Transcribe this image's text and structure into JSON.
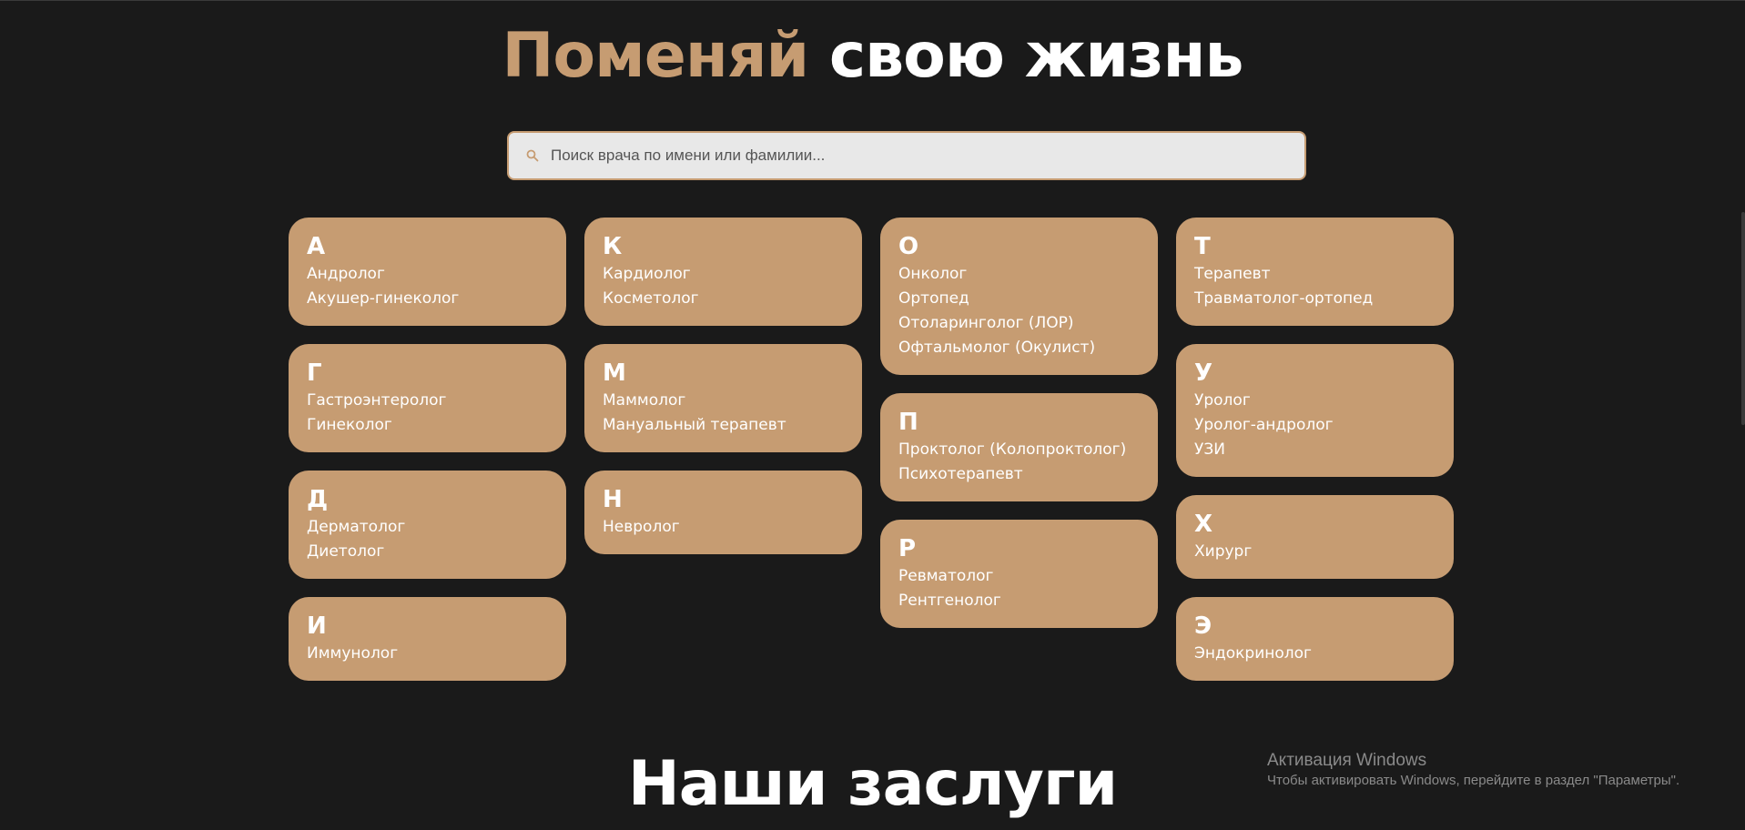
{
  "hero": {
    "title_accent": "Поменяй",
    "title_rest": "свою жизнь"
  },
  "search": {
    "placeholder": "Поиск врача по имени или фамилии...",
    "value": "",
    "icon": "search-icon"
  },
  "columns": [
    [
      {
        "letter": "А",
        "items": [
          "Андролог",
          "Акушер-гинеколог"
        ]
      },
      {
        "letter": "Г",
        "items": [
          "Гастроэнтеролог",
          "Гинеколог"
        ]
      },
      {
        "letter": "Д",
        "items": [
          "Дерматолог",
          "Диетолог"
        ]
      },
      {
        "letter": "И",
        "items": [
          "Иммунолог"
        ]
      }
    ],
    [
      {
        "letter": "К",
        "items": [
          "Кардиолог",
          "Косметолог"
        ]
      },
      {
        "letter": "М",
        "items": [
          "Маммолог",
          "Мануальный терапевт"
        ]
      },
      {
        "letter": "Н",
        "items": [
          "Невролог"
        ]
      }
    ],
    [
      {
        "letter": "О",
        "items": [
          "Онколог",
          "Ортопед",
          "Отоларинголог (ЛОР)",
          "Офтальмолог (Окулист)"
        ]
      },
      {
        "letter": "П",
        "items": [
          "Проктолог (Колопроктолог)",
          "Психотерапевт"
        ]
      },
      {
        "letter": "Р",
        "items": [
          "Ревматолог",
          "Рентгенолог"
        ]
      }
    ],
    [
      {
        "letter": "Т",
        "items": [
          "Терапевт",
          "Травматолог-ортопед"
        ]
      },
      {
        "letter": "У",
        "items": [
          "Уролог",
          "Уролог-андролог",
          "УЗИ"
        ]
      },
      {
        "letter": "Х",
        "items": [
          "Хирург"
        ]
      },
      {
        "letter": "Э",
        "items": [
          "Эндокринолог"
        ]
      }
    ]
  ],
  "merits": {
    "title": "Наши заслуги"
  },
  "windows_activation": {
    "title": "Активация Windows",
    "subtitle": "Чтобы активировать Windows, перейдите в раздел \"Параметры\"."
  },
  "colors": {
    "background": "#1a1a1a",
    "accent": "#c69c72",
    "card": "#c69c72",
    "text": "#ffffff",
    "search_bg": "#e8e8e8"
  }
}
